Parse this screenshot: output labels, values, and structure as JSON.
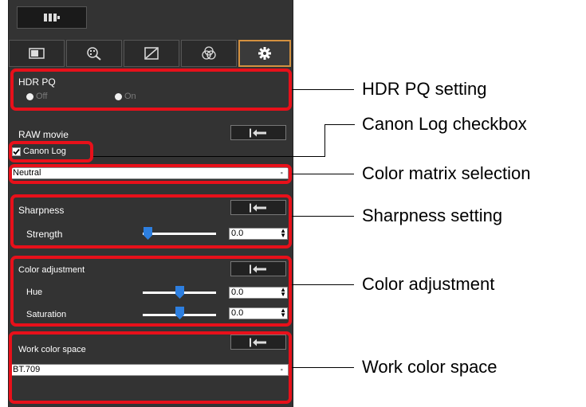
{
  "panel": {
    "tabs": [
      {
        "name": "image-tab",
        "icon": "image-icon"
      },
      {
        "name": "noise-tab",
        "icon": "magnifier-grid-icon"
      },
      {
        "name": "tone-tab",
        "icon": "tone-curve-icon"
      },
      {
        "name": "color-tab",
        "icon": "color-circles-icon"
      },
      {
        "name": "settings-tab",
        "icon": "gear-icon",
        "active": true
      }
    ],
    "top_button_icon": "film-strip-icon",
    "hdr": {
      "title": "HDR PQ",
      "off_label": "Off",
      "on_label": "On",
      "selected": "On"
    },
    "raw": {
      "title": "RAW movie",
      "canon_log_label": "Canon Log",
      "canon_log_checked": true
    },
    "color_matrix": {
      "value": "Neutral"
    },
    "sharpness": {
      "title": "Sharpness",
      "strength_label": "Strength",
      "strength_value": "0.0"
    },
    "color_adj": {
      "title": "Color adjustment",
      "hue_label": "Hue",
      "hue_value": "0.0",
      "sat_label": "Saturation",
      "sat_value": "0.0"
    },
    "work_space": {
      "title": "Work color space",
      "value": "BT.709"
    }
  },
  "callouts": {
    "hdr": "HDR PQ setting",
    "canon_log": "Canon Log checkbox",
    "matrix": "Color matrix selection",
    "sharpness": "Sharpness setting",
    "color_adj": "Color adjustment",
    "work_space": "Work color space"
  },
  "colors": {
    "highlight": "#e8101a",
    "active_tab": "#d4913f",
    "slider": "#2d7fe0",
    "panel_bg": "#333333"
  }
}
